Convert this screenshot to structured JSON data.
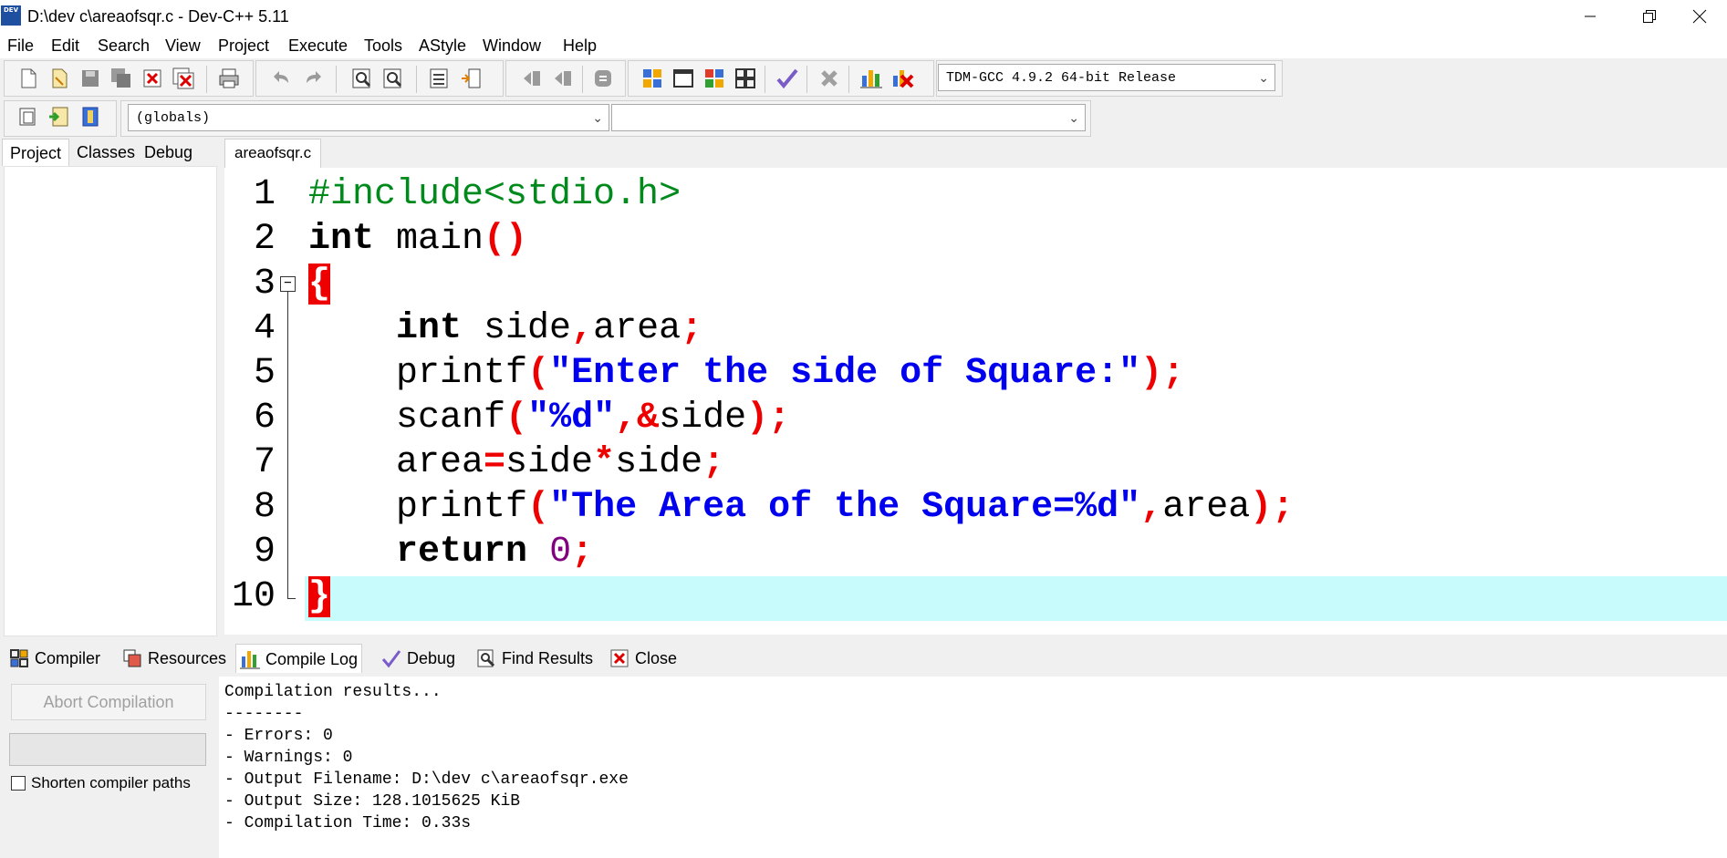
{
  "window": {
    "title": "D:\\dev c\\areaofsqr.c - Dev-C++ 5.11",
    "app_icon_text": "DEV",
    "controls": [
      "minimize-icon",
      "restore-icon",
      "close-icon"
    ]
  },
  "menu": [
    "File",
    "Edit",
    "Search",
    "View",
    "Project",
    "Execute",
    "Tools",
    "AStyle",
    "Window",
    "Help"
  ],
  "toolbar": {
    "compiler_select": "TDM-GCC 4.9.2 64-bit Release",
    "scope_select": "(globals)",
    "function_select": ""
  },
  "left_tabs": [
    "Project",
    "Classes",
    "Debug"
  ],
  "editor": {
    "file_tab": "areaofsqr.c",
    "line_numbers": [
      "1",
      "2",
      "3",
      "4",
      "5",
      "6",
      "7",
      "8",
      "9",
      "10"
    ],
    "highlight_color": "#c8fcfc",
    "lines": [
      "#include<stdio.h>",
      "int main()",
      "{",
      "    int side,area;",
      "    printf(\"Enter the side of Square:\");",
      "    scanf(\"%d\",&side);",
      "    area=side*side;",
      "    printf(\"The Area of the Square=%d\",area);",
      "    return 0;",
      "}"
    ]
  },
  "bottom_tabs": [
    "Compiler",
    "Resources",
    "Compile Log",
    "Debug",
    "Find Results",
    "Close"
  ],
  "bottom_panel": {
    "abort_button": "Abort Compilation",
    "shorten_paths_label": "Shorten compiler paths",
    "shorten_paths_checked": false,
    "log": [
      "Compilation results...",
      "--------",
      "- Errors: 0",
      "- Warnings: 0",
      "- Output Filename: D:\\dev c\\areaofsqr.exe",
      "- Output Size: 128.1015625 KiB",
      "- Compilation Time: 0.33s"
    ]
  },
  "colors": {
    "preprocessor": "#008a1c",
    "string": "#0000ee",
    "symbol": "#ee0000",
    "number": "#800080",
    "current_line": "#c8fcfc"
  }
}
